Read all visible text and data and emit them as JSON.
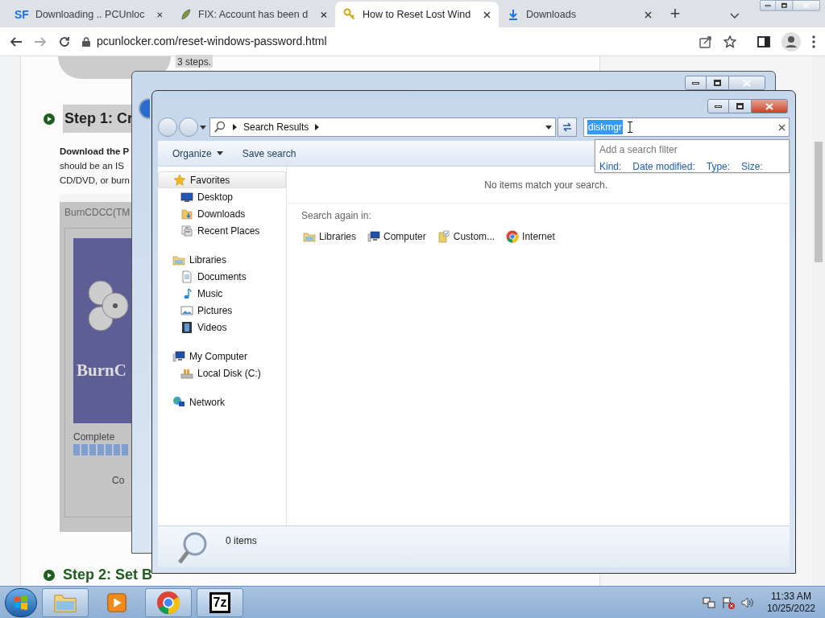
{
  "browser": {
    "tabs": [
      {
        "label": "Downloading .. PCUnloc",
        "kind": "text-logo",
        "icon_text": "SF",
        "selected": false
      },
      {
        "label": "FIX: Account has been d",
        "kind": "leaf",
        "selected": false
      },
      {
        "label": "How to Reset Lost Wind",
        "kind": "key",
        "selected": true
      },
      {
        "label": "Downloads",
        "kind": "download",
        "selected": false
      }
    ],
    "new_tab": "+",
    "url": "pcunlocker.com/reset-windows-password.html"
  },
  "page": {
    "intro": "3 steps.",
    "step1": "Step 1: Cr",
    "download_bold": "Download the P",
    "lines": [
      "should be an IS",
      "CD/DVD, or burn"
    ],
    "dialog": {
      "title": "BurnCDCC(TM",
      "image_text": "BurnC",
      "status": "Complete",
      "button": "Co"
    },
    "step2": "Step 2: Set B"
  },
  "explorer": {
    "breadcrumb": [
      "Search Results"
    ],
    "search_value": "diskmgr",
    "filter": {
      "title": "Add a search filter",
      "items": [
        "Kind:",
        "Date modified:",
        "Type:",
        "Size:"
      ]
    },
    "toolbar": [
      {
        "label": "Organize",
        "dropdown": true
      },
      {
        "label": "Save search",
        "dropdown": false
      }
    ],
    "nav": [
      {
        "label": "Favorites",
        "kind": "star",
        "selected": true,
        "children": [
          {
            "label": "Desktop",
            "kind": "desktop"
          },
          {
            "label": "Downloads",
            "kind": "downloads"
          },
          {
            "label": "Recent Places",
            "kind": "recent"
          }
        ]
      },
      {
        "label": "Libraries",
        "kind": "libraries",
        "selected": false,
        "children": [
          {
            "label": "Documents",
            "kind": "document"
          },
          {
            "label": "Music",
            "kind": "music"
          },
          {
            "label": "Pictures",
            "kind": "pictures"
          },
          {
            "label": "Videos",
            "kind": "videos"
          }
        ]
      },
      {
        "label": "My Computer",
        "kind": "computer",
        "selected": false,
        "children": [
          {
            "label": "Local Disk (C:)",
            "kind": "disk"
          }
        ]
      },
      {
        "label": "Network",
        "kind": "network",
        "selected": false
      }
    ],
    "message": "No items match your search.",
    "search_again": {
      "label": "Search again in:",
      "items": [
        {
          "label": "Libraries",
          "kind": "libraries"
        },
        {
          "label": "Computer",
          "kind": "computer"
        },
        {
          "label": "Custom...",
          "kind": "custom"
        },
        {
          "label": "Internet",
          "kind": "chrome"
        }
      ]
    },
    "status": "0 items"
  },
  "taskbar": {
    "apps": [
      {
        "kind": "folder"
      },
      {
        "kind": "media"
      },
      {
        "kind": "chrome"
      },
      {
        "kind": "text-logo",
        "text": "7z"
      }
    ],
    "time": "11:33 AM",
    "date": "10/25/2022"
  }
}
